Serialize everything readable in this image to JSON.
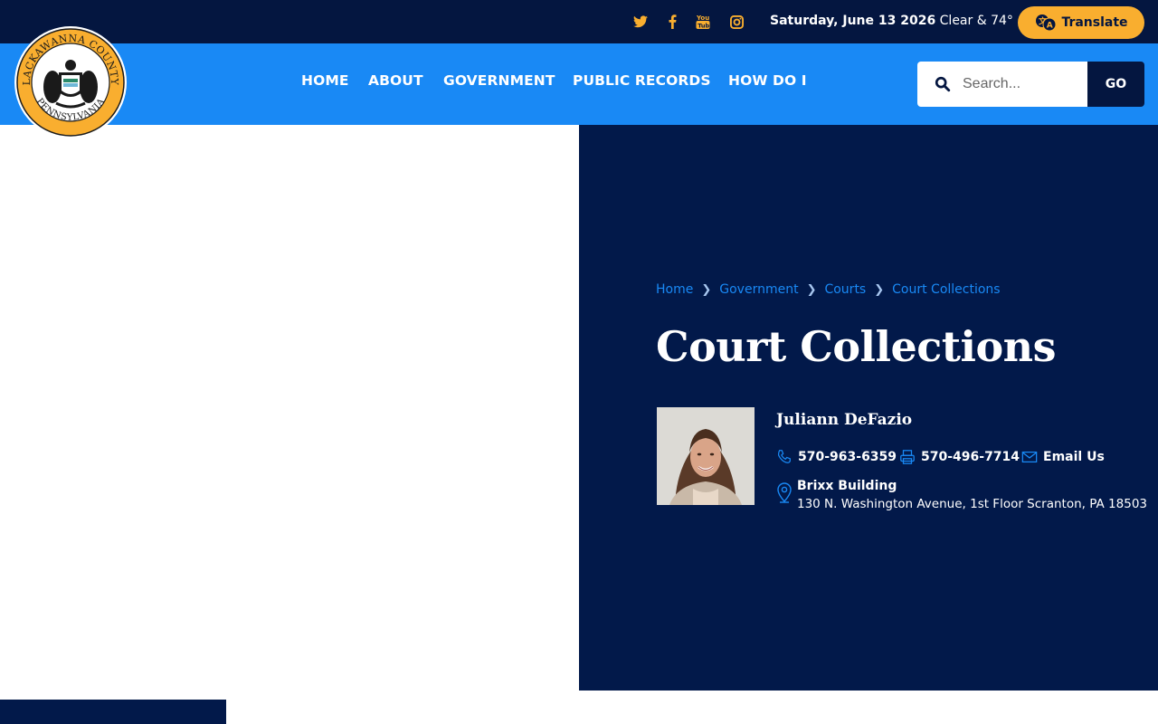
{
  "topbar": {
    "social": [
      "twitter-icon",
      "facebook-icon",
      "youtube-icon",
      "instagram-icon"
    ],
    "date": "Saturday, June 13 2026",
    "weather": "Clear & 74°",
    "translate_label": "Translate"
  },
  "logo": {
    "ring_top": "LACKAWANNA COUNTY",
    "ring_bottom": "PENNSYLVANIA"
  },
  "nav": {
    "items": [
      {
        "label": "HOME"
      },
      {
        "label": "ABOUT"
      },
      {
        "label": "GOVERNMENT"
      },
      {
        "label": "PUBLIC RECORDS"
      },
      {
        "label": "HOW DO I"
      }
    ]
  },
  "search": {
    "placeholder": "Search...",
    "go_label": "GO"
  },
  "breadcrumb": [
    "Home",
    "Government",
    "Courts",
    "Court Collections"
  ],
  "page": {
    "title": "Court Collections"
  },
  "contact": {
    "name": "Juliann DeFazio",
    "phone": "570-963-6359",
    "fax": "570-496-7714",
    "email_label": "Email Us",
    "building": "Brixx Building",
    "address": "130 N. Washington Avenue, 1st Floor Scranton, PA 18503"
  },
  "colors": {
    "topbar": "#041640",
    "nav": "#1989f5",
    "hero": "#02194a",
    "accent": "#f9ae2f"
  }
}
